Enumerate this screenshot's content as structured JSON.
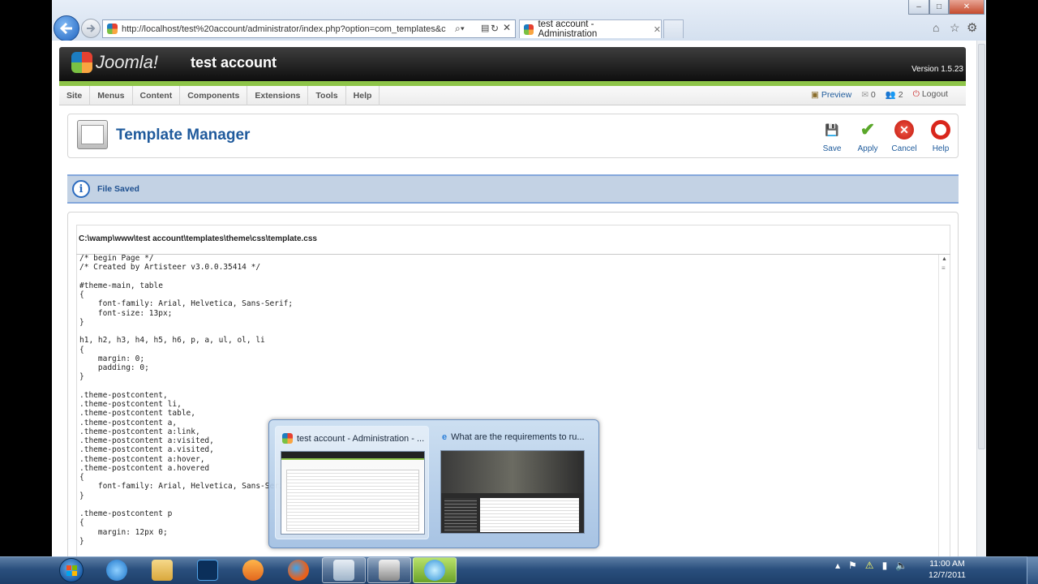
{
  "browser": {
    "url": "http://localhost/test%20account/administrator/index.php?option=com_templates&c",
    "active_tab_title": "test account - Administration",
    "window_buttons": [
      "–",
      "□",
      "✕"
    ]
  },
  "joomla": {
    "logo_text": "Joomla!",
    "site_name": "test account",
    "version": "Version 1.5.23",
    "menu": [
      "Site",
      "Menus",
      "Content",
      "Components",
      "Extensions",
      "Tools",
      "Help"
    ],
    "status": {
      "preview": "Preview",
      "messages": "0",
      "users": "2",
      "logout": "Logout"
    }
  },
  "toolbar": {
    "title": "Template Manager",
    "buttons": [
      {
        "label": "Save",
        "icon": "save-icon"
      },
      {
        "label": "Apply",
        "icon": "apply-icon"
      },
      {
        "label": "Cancel",
        "icon": "cancel-icon"
      },
      {
        "label": "Help",
        "icon": "help-icon"
      }
    ]
  },
  "message": {
    "text": "File Saved"
  },
  "editor": {
    "file_path": "C:\\wamp\\www\\test account\\templates\\theme\\css\\template.css",
    "code": "/* begin Page */\n/* Created by Artisteer v3.0.0.35414 */\n\n#theme-main, table\n{\n    font-family: Arial, Helvetica, Sans-Serif;\n    font-size: 13px;\n}\n\nh1, h2, h3, h4, h5, h6, p, a, ul, ol, li\n{\n    margin: 0;\n    padding: 0;\n}\n\n.theme-postcontent,\n.theme-postcontent li,\n.theme-postcontent table,\n.theme-postcontent a,\n.theme-postcontent a:link,\n.theme-postcontent a:visited,\n.theme-postcontent a.visited,\n.theme-postcontent a:hover,\n.theme-postcontent a.hovered\n{\n    font-family: Arial, Helvetica, Sans-Serif;\n}\n\n.theme-postcontent p\n{\n    margin: 12px 0;\n}"
  },
  "taskbar_popup": {
    "thumbs": [
      {
        "title": "test account - Administration - ..."
      },
      {
        "title": "What are the requirements to ru..."
      }
    ]
  },
  "taskbar": {
    "clock_time": "11:00 AM",
    "clock_date": "12/7/2011"
  },
  "colors": {
    "joomla_green": "#8ec549",
    "title_blue": "#1f5a9c"
  }
}
